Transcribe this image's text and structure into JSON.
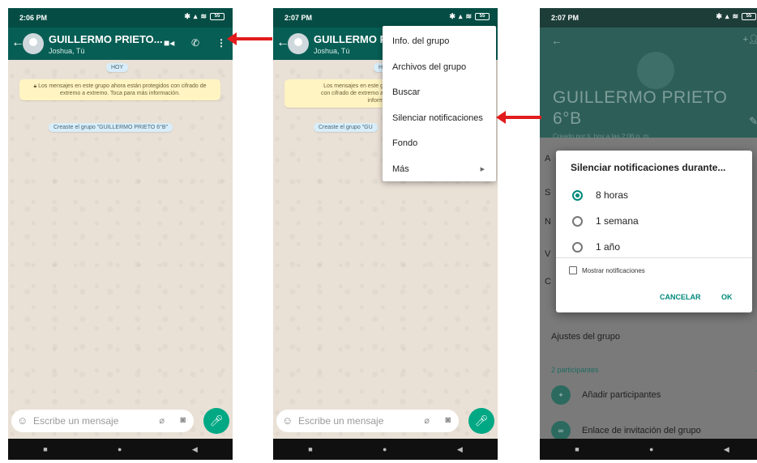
{
  "screens": {
    "one": {
      "status_time": "2:06 PM",
      "battery": "55",
      "group_name": "GUILLERMO PRIETO...",
      "group_members": "Joshua, Tú",
      "date_chip": "HOY",
      "encryption_notice": "Los mensajes en este grupo ahora están protegidos con cifrado de extremo a extremo. Toca para más información.",
      "created_notice": "Creaste el grupo \"GUILLERMO PRIETO 6°B\"",
      "input_placeholder": "Escribe un mensaje"
    },
    "two": {
      "status_time": "2:07 PM",
      "battery": "55",
      "group_name": "GUILLERMO PF",
      "group_members": "Joshua, Tú",
      "date_chip": "H",
      "notice_fragment_1": "Los mensajes en este g",
      "notice_fragment_2": "con cifrado de extremo a",
      "notice_fragment_3": "inform",
      "created_fragment": "Creaste el grupo \"GU",
      "input_placeholder": "Escribe un mensaje",
      "menu_items": [
        "Info. del grupo",
        "Archivos del grupo",
        "Buscar",
        "Silenciar notificaciones",
        "Fondo",
        "Más"
      ]
    },
    "three": {
      "status_time": "2:07 PM",
      "battery": "55",
      "group_title_line1": "GUILLERMO PRIETO",
      "group_title_line2": "6°B",
      "created_info": "Creado por ti, hoy a las 2:06 p. m.",
      "dialog_title": "Silenciar notificaciones durante...",
      "options": [
        "8 horas",
        "1 semana",
        "1 año"
      ],
      "selected_option": "8 horas",
      "checkbox_label": "Mostrar notificaciones",
      "cancel_label": "CANCELAR",
      "ok_label": "OK",
      "group_settings": "Ajustes del grupo",
      "participants_count": "2 participantes",
      "add_participants": "Añadir participantes",
      "invite_link": "Enlace de invitación del grupo",
      "partial_letters": [
        "A",
        "S",
        "N",
        "V",
        "C"
      ]
    }
  },
  "colors": {
    "appbar": "#075e54",
    "accent": "#00a884",
    "arrow": "#e21c1c"
  }
}
